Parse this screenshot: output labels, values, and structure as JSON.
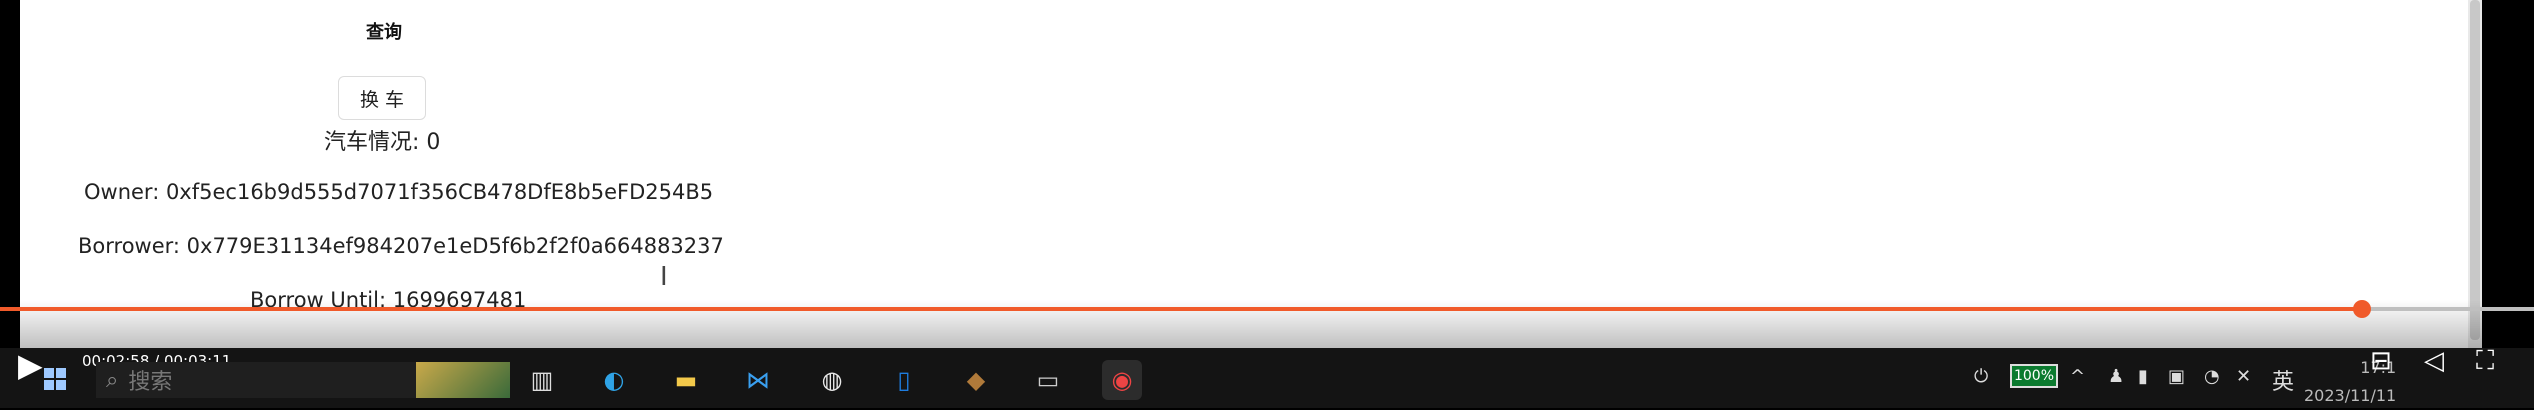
{
  "page": {
    "query_title": "查询",
    "swap_button": "换 车",
    "car_status": "汽车情况: 0",
    "owner": "Owner: 0xf5ec16b9d555d7071f356CB478DfE8b5eFD254B5",
    "borrower": "Borrower: 0x779E31134ef984207e1eD5f6b2f2f0a664883237",
    "borrow_until": "Borrow Until: 1699697481"
  },
  "player": {
    "time": "00:02:58 / 00:03:11",
    "progress": 0.932,
    "accent": "#f05a2a"
  },
  "taskbar": {
    "search_placeholder": "搜索",
    "battery": "100%",
    "ime": "英",
    "time": "17:1",
    "date": "2023/11/11",
    "apps": [
      "task-view-icon",
      "edge-icon",
      "file-explorer-icon",
      "vscode-icon",
      "app-icon",
      "phone-icon",
      "box-icon",
      "terminal-icon",
      "chrome-icon"
    ]
  }
}
